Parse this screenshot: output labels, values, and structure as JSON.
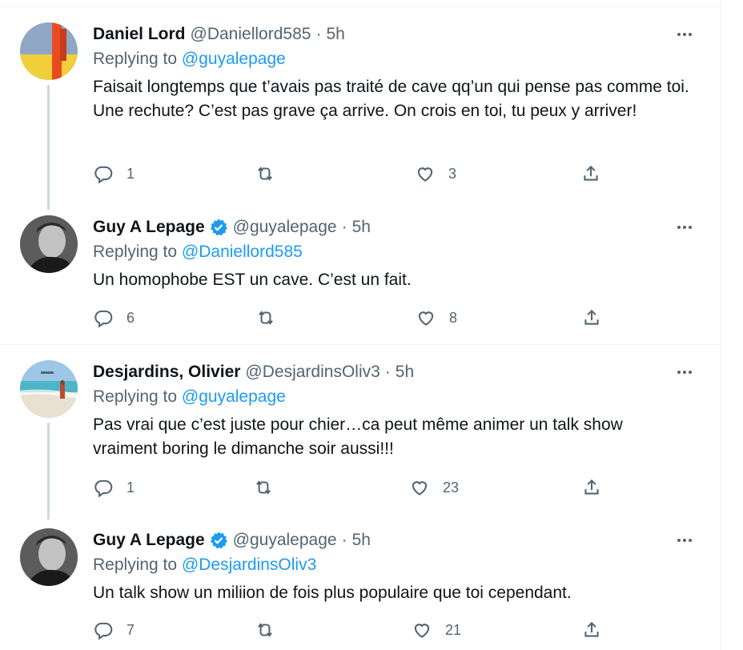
{
  "tweets": [
    {
      "name": "Daniel Lord",
      "handle": "@Daniellord585",
      "time": "5h",
      "verified": false,
      "replying_label": "Replying to",
      "replying_to": "@guyalepage",
      "text": "Faisait longtemps que t’avais pas traité de cave qq’un qui pense pas comme toi. Une rechute? C’est pas grave ça arrive. On crois en toi, tu peux y arriver!",
      "reply_count": "1",
      "retweet_count": "",
      "like_count": "3"
    },
    {
      "name": "Guy A Lepage",
      "handle": "@guyalepage",
      "time": "5h",
      "verified": true,
      "replying_label": "Replying to",
      "replying_to": "@Daniellord585",
      "text": "Un homophobe EST un cave. C’est un fait.",
      "reply_count": "6",
      "retweet_count": "",
      "like_count": "8"
    },
    {
      "name": "Desjardins, Olivier",
      "handle": "@DesjardinsOliv3",
      "time": "5h",
      "verified": false,
      "replying_label": "Replying to",
      "replying_to": "@guyalepage",
      "text": "Pas vrai que c’est juste pour chier…ca peut même animer un talk show vraiment boring le dimanche soir aussi!!!",
      "reply_count": "1",
      "retweet_count": "",
      "like_count": "23"
    },
    {
      "name": "Guy A Lepage",
      "handle": "@guyalepage",
      "time": "5h",
      "verified": true,
      "replying_label": "Replying to",
      "replying_to": "@DesjardinsOliv3",
      "text": "Un talk show un miliion de fois plus populaire que toi cependant.",
      "reply_count": "7",
      "retweet_count": "",
      "like_count": "21"
    }
  ],
  "separator_dot": "·",
  "colors": {
    "text": "#0f1419",
    "secondary": "#536471",
    "link": "#1d9bf0",
    "border": "#eff3f4",
    "thread_line": "#cfd9de"
  },
  "icons": [
    "reply-icon",
    "retweet-icon",
    "like-icon",
    "share-icon",
    "more-icon",
    "verified-badge-icon"
  ]
}
